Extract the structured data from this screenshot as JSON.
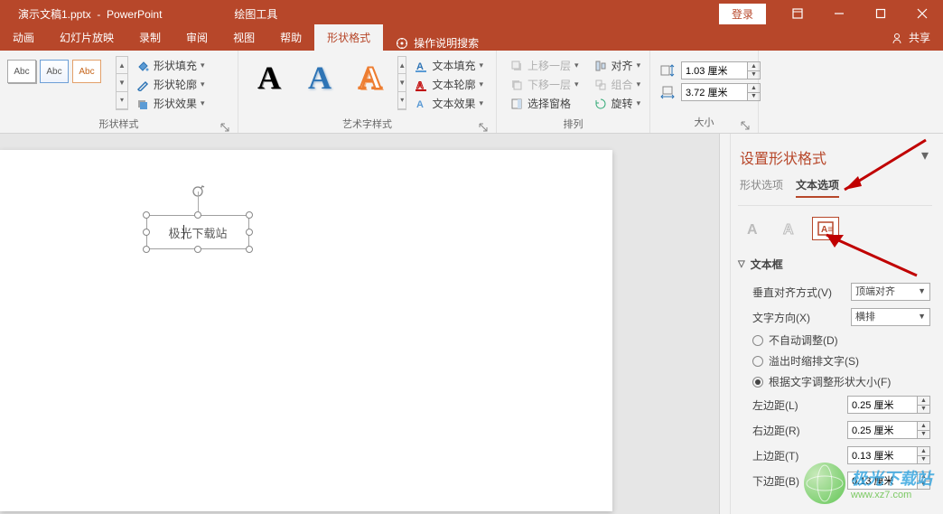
{
  "titlebar": {
    "filename": "演示文稿1.pptx",
    "app": "PowerPoint",
    "tool_context": "绘图工具",
    "login": "登录",
    "share": "共享"
  },
  "ribbon_tabs": [
    "动画",
    "幻灯片放映",
    "录制",
    "审阅",
    "视图",
    "帮助",
    "形状格式"
  ],
  "ribbon_active_tab": "形状格式",
  "tell_me": "操作说明搜索",
  "groups": {
    "shape_styles": {
      "label": "形状样式",
      "abc": "Abc",
      "fill": "形状填充",
      "outline": "形状轮廓",
      "effects": "形状效果"
    },
    "wordart": {
      "label": "艺术字样式",
      "text_fill": "文本填充",
      "text_outline": "文本轮廓",
      "text_effects": "文本效果"
    },
    "arrange": {
      "label": "排列",
      "bring_forward": "上移一层",
      "send_backward": "下移一层",
      "selection_pane": "选择窗格",
      "align": "对齐",
      "group": "组合",
      "rotate": "旋转"
    },
    "size": {
      "label": "大小",
      "height": "1.03 厘米",
      "width": "3.72 厘米"
    }
  },
  "slide": {
    "shape_text": "极光下载站"
  },
  "pane": {
    "title": "设置形状格式",
    "tab_shape": "形状选项",
    "tab_text": "文本选项",
    "section": "文本框",
    "valign_label": "垂直对齐方式(V)",
    "valign_value": "顶端对齐",
    "textdir_label": "文字方向(X)",
    "textdir_value": "横排",
    "r_noauto": "不自动调整(D)",
    "r_shrink": "溢出时缩排文字(S)",
    "r_resize": "根据文字调整形状大小(F)",
    "m_left_label": "左边距(L)",
    "m_left": "0.25 厘米",
    "m_right_label": "右边距(R)",
    "m_right": "0.25 厘米",
    "m_top_label": "上边距(T)",
    "m_top": "0.13 厘米",
    "m_bottom_label": "下边距(B)",
    "m_bottom": "0.13 厘米"
  },
  "watermark": {
    "cn": "极光下载站",
    "en": "www.xz7.com"
  },
  "colors": {
    "brand": "#b7472a"
  }
}
